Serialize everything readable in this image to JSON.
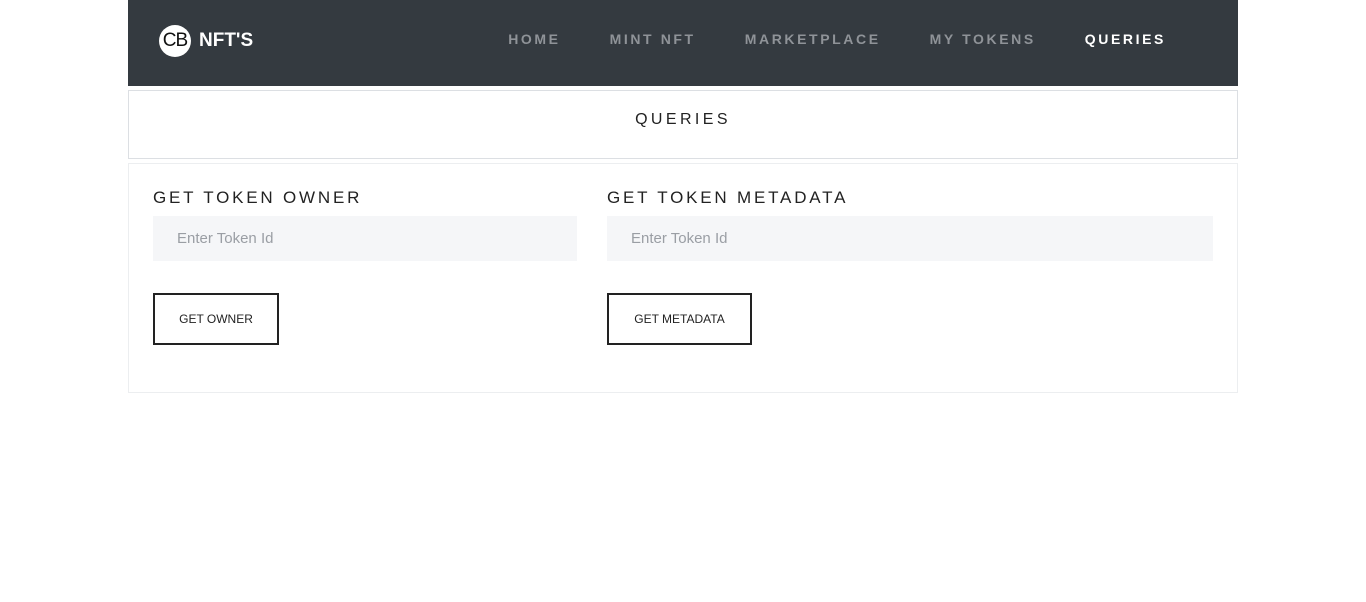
{
  "navbar": {
    "logo_text": "CB",
    "brand": "NFT'S",
    "links": [
      {
        "label": "HOME",
        "active": false
      },
      {
        "label": "MINT NFT",
        "active": false
      },
      {
        "label": "MARKETPLACE",
        "active": false
      },
      {
        "label": "MY TOKENS",
        "active": false
      },
      {
        "label": "QUERIES",
        "active": true
      }
    ]
  },
  "page": {
    "title": "QUERIES"
  },
  "owner_query": {
    "heading": "GET TOKEN OWNER",
    "input_placeholder": "Enter Token Id",
    "input_value": "",
    "button_label": "GET OWNER"
  },
  "metadata_query": {
    "heading": "GET TOKEN METADATA",
    "input_placeholder": "Enter Token Id",
    "input_value": "",
    "button_label": "GET METADATA"
  },
  "colors": {
    "navbar_bg": "#343a40",
    "nav_inactive": "#8f9398",
    "nav_active": "#ffffff",
    "input_bg": "#f5f6f8"
  }
}
